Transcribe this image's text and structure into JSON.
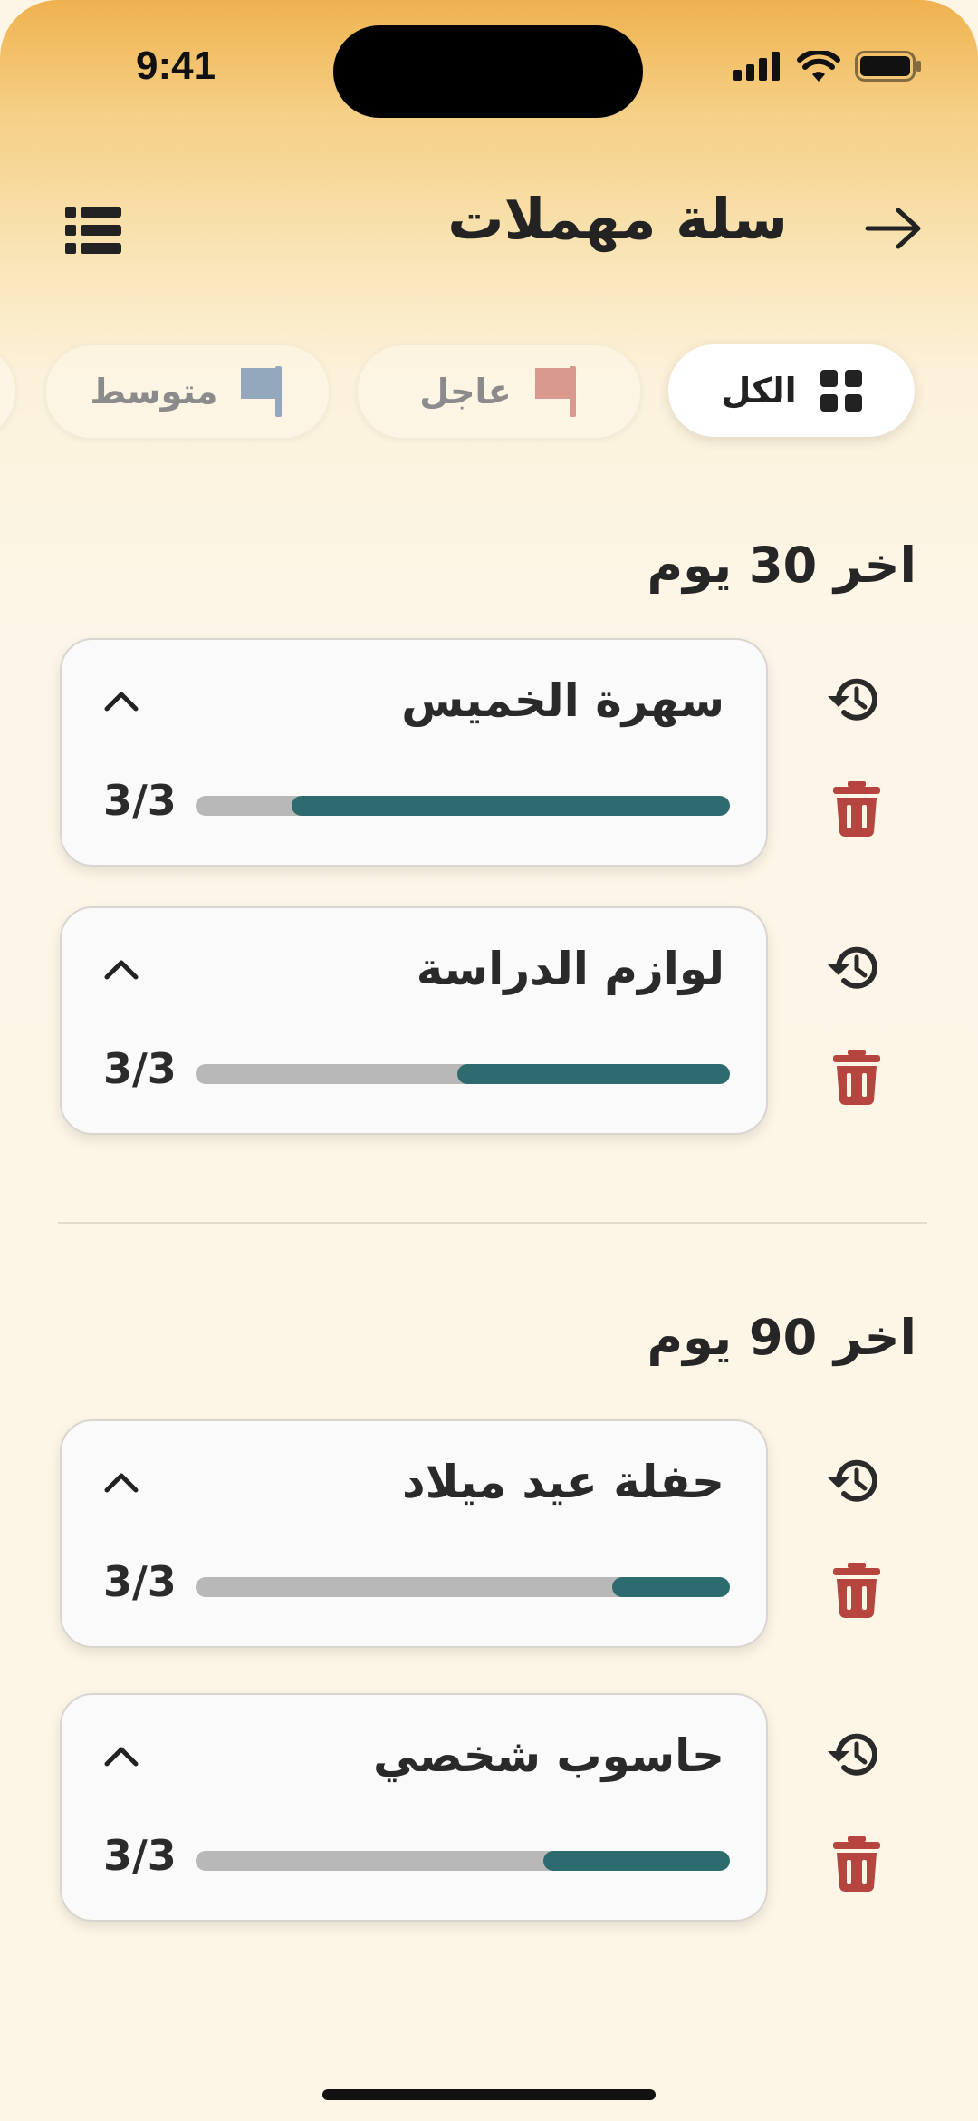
{
  "status": {
    "time": "9:41"
  },
  "header": {
    "title": "سلة مهملات"
  },
  "filters": [
    {
      "label": "الكل",
      "icon": "grid-icon"
    },
    {
      "label": "عاجل",
      "icon": "flag-icon",
      "color": "#d9998f"
    },
    {
      "label": "متوسط",
      "icon": "flag-icon",
      "color": "#93a7bd"
    }
  ],
  "sections": [
    {
      "title": "اخر 30 يوم",
      "items": [
        {
          "name": "سهرة الخميس",
          "count": "3/3",
          "progress": 0.82
        },
        {
          "name": "لوازم الدراسة",
          "count": "3/3",
          "progress": 0.51
        }
      ]
    },
    {
      "title": "اخر 90 يوم",
      "items": [
        {
          "name": "حفلة عيد ميلاد",
          "count": "3/3",
          "progress": 0.22
        },
        {
          "name": "حاسوب شخصي",
          "count": "3/3",
          "progress": 0.35
        }
      ]
    }
  ],
  "colors": {
    "accent": "#2e6b6f",
    "delete": "#b5453e",
    "track": "#b8b8b8"
  }
}
